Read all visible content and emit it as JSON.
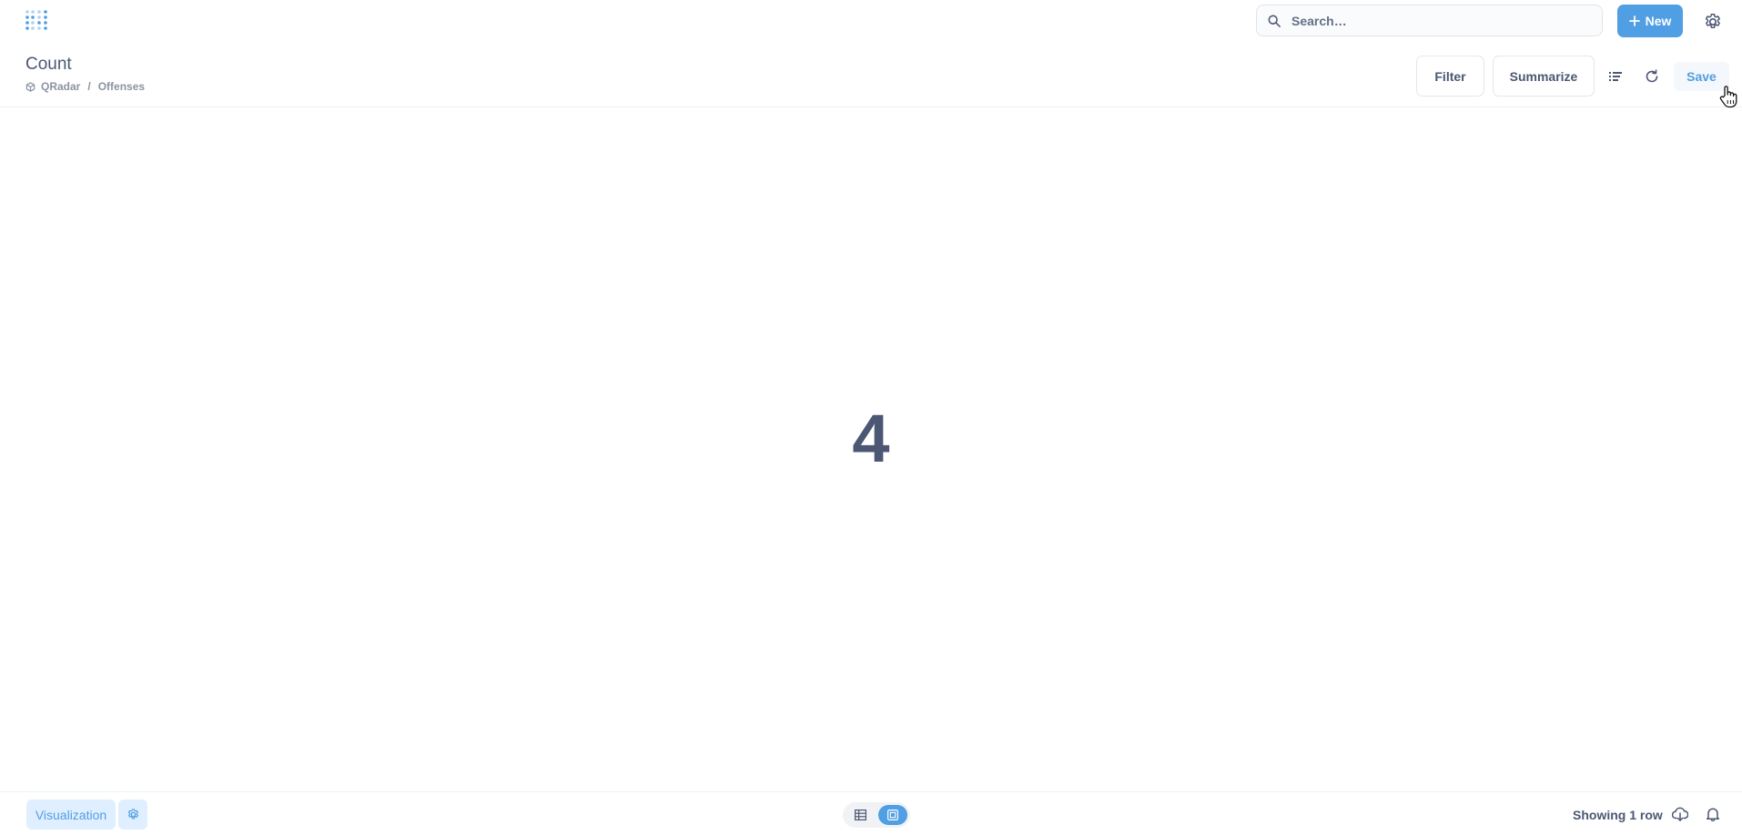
{
  "topnav": {
    "logo_icon": "metabase-logo-icon",
    "search_placeholder": "Search…",
    "new_label": "New",
    "settings_icon": "gear-icon"
  },
  "header": {
    "title": "Count",
    "breadcrumb": {
      "database_icon": "database-icon",
      "database": "QRadar",
      "separator": "/",
      "table": "Offenses"
    },
    "filter_label": "Filter",
    "summarize_label": "Summarize",
    "save_label": "Save"
  },
  "main": {
    "scalar_value": "4"
  },
  "footer": {
    "visualization_label": "Visualization",
    "view_toggle": {
      "options": [
        "table-view",
        "visualization-view"
      ],
      "active": "visualization-view"
    },
    "row_count_text": "Showing 1 row"
  },
  "colors": {
    "brand": "#509ee3",
    "text": "#4c5773",
    "muted": "#8b94a3",
    "border": "#e3e6ea"
  }
}
